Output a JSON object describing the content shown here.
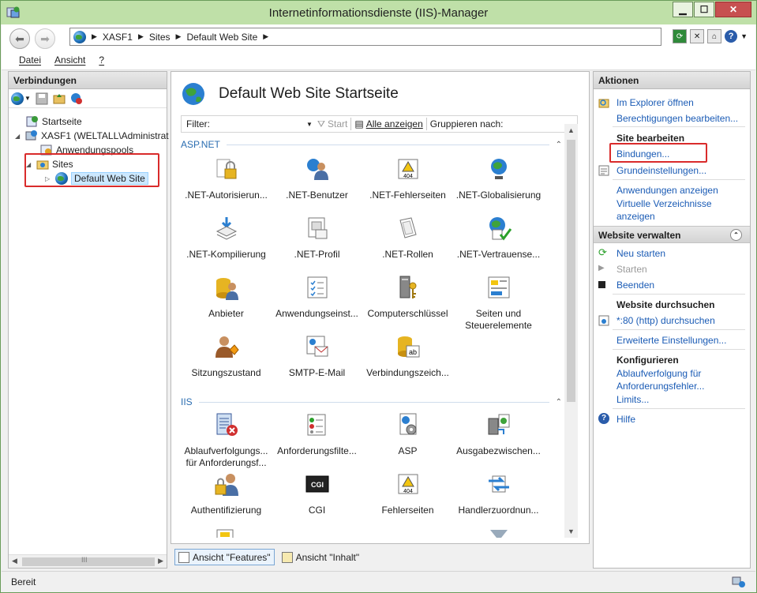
{
  "window": {
    "title": "Internetinformationsdienste (IIS)-Manager",
    "controls": {
      "minimize": "▁",
      "maximize": "☐",
      "close": "✕"
    }
  },
  "navigation": {
    "back_icon": "arrow-left",
    "forward_icon": "arrow-right",
    "breadcrumb": [
      "XASF1",
      "Sites",
      "Default Web Site"
    ],
    "separator": "▶",
    "tools_help": "?"
  },
  "menu": [
    "Datei",
    "Ansicht",
    "?"
  ],
  "connections": {
    "header": "Verbindungen",
    "tree": {
      "startseite": "Startseite",
      "server": "XASF1 (WELTALL\\Administrat",
      "apppools": "Anwendungspools",
      "sites": "Sites",
      "defaultsite": "Default Web Site"
    },
    "expanders": {
      "server": "◢",
      "sites": "◢",
      "defaultsite": "▷"
    },
    "scroll_grip": "III"
  },
  "center": {
    "title": "Default Web Site Startseite",
    "filter": {
      "label": "Filter:",
      "start": "Start",
      "show_all": "Alle anzeigen",
      "group_by": "Gruppieren nach:"
    },
    "groups": {
      "aspnet": "ASP.NET",
      "iis": "IIS"
    },
    "aspnet_features": [
      ".NET-Autorisierun...",
      ".NET-Benutzer",
      ".NET-Fehlerseiten",
      ".NET-Globalisierung",
      ".NET-Kompilierung",
      ".NET-Profil",
      ".NET-Rollen",
      ".NET-Vertrauense...",
      "Anbieter",
      "Anwendungseinst...",
      "Computerschlüssel",
      "Seiten und Steuerelemente",
      "Sitzungszustand",
      "SMTP-E-Mail",
      "Verbindungszeich..."
    ],
    "iis_features": [
      "Ablaufverfolgungs... für Anforderungsf...",
      "Anforderungsfilte...",
      "ASP",
      "Ausgabezwischen...",
      "Authentifizierung",
      "CGI",
      "Fehlerseiten",
      "Handlerzuordnun..."
    ],
    "icon_texts": {
      "err404": "404",
      "cgi": "CGI",
      "ab": "ab"
    },
    "view_tabs": [
      "Ansicht \"Features\"",
      "Ansicht \"Inhalt\""
    ]
  },
  "actions": {
    "header": "Aktionen",
    "explore": "Im Explorer öffnen",
    "permissions": "Berechtigungen bearbeiten...",
    "edit_site_header": "Site bearbeiten",
    "bindings": "Bindungen...",
    "basic_settings": "Grundeinstellungen...",
    "view_apps": "Anwendungen anzeigen",
    "view_vdirs": "Virtuelle Verzeichnisse anzeigen",
    "manage_header": "Website verwalten",
    "restart": "Neu starten",
    "start": "Starten",
    "stop": "Beenden",
    "browse_header": "Website durchsuchen",
    "browse_80": "*:80 (http) durchsuchen",
    "advanced": "Erweiterte Einstellungen...",
    "configure_header": "Konfigurieren",
    "failed_tracing": "Ablaufverfolgung für Anforderungsfehler...",
    "limits": "Limits...",
    "help": "Hilfe"
  },
  "status": {
    "text": "Bereit"
  },
  "colors": {
    "link": "#1a5bb5",
    "highlight_box": "#d92b2b",
    "group_header": "#2a6db1"
  }
}
